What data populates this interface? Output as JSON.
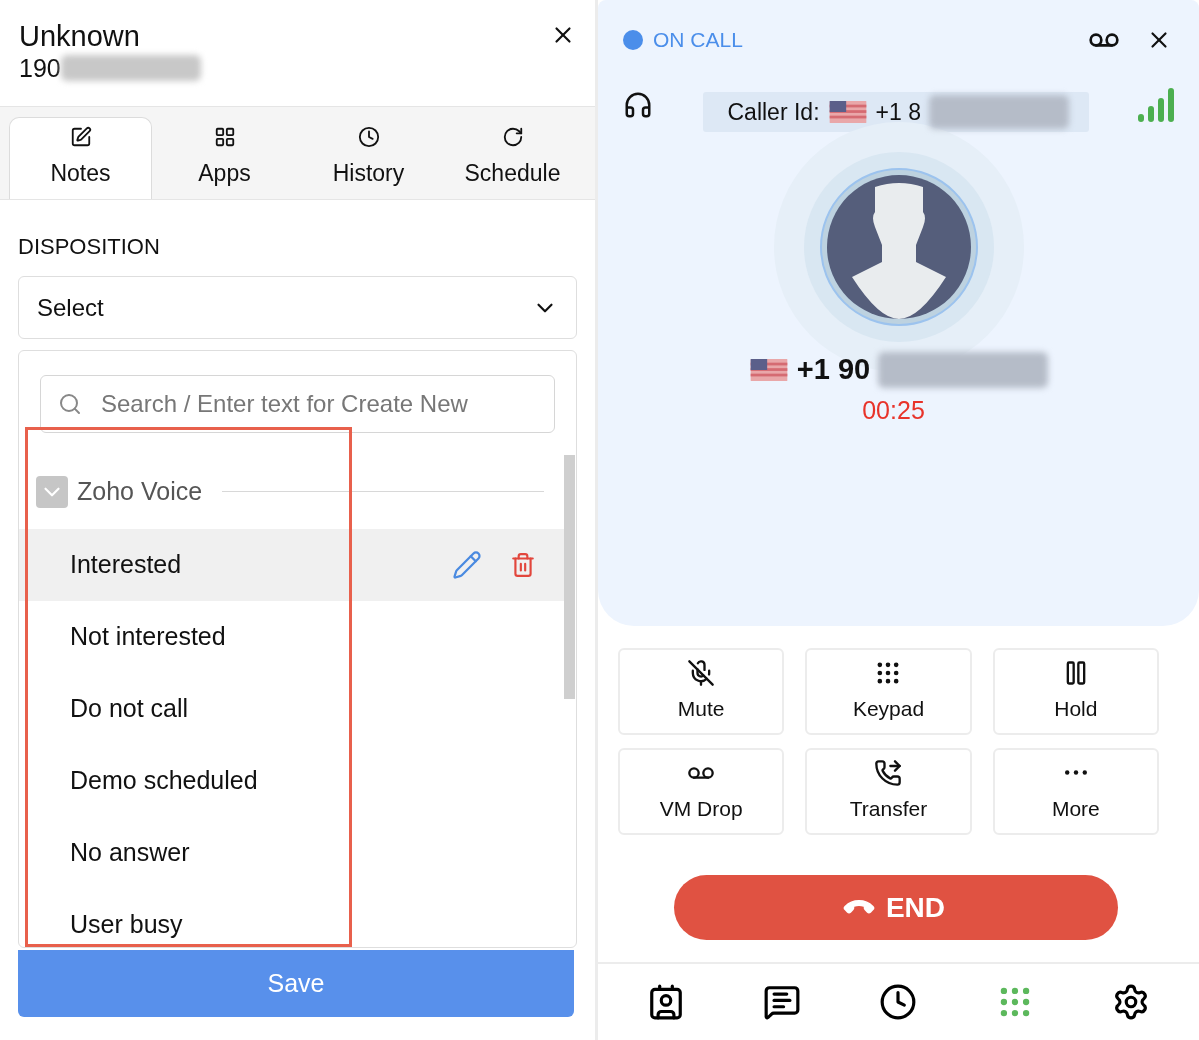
{
  "contact": {
    "name": "Unknown",
    "number": "190"
  },
  "tabs": [
    {
      "label": "Notes",
      "selected": true
    },
    {
      "label": "Apps",
      "selected": false
    },
    {
      "label": "History",
      "selected": false
    },
    {
      "label": "Schedule",
      "selected": false
    }
  ],
  "disposition": {
    "label": "DISPOSITION",
    "value": "Select",
    "search_placeholder": "Search / Enter text for Create New",
    "group": {
      "name": "Zoho Voice",
      "expanded": true
    },
    "options": [
      {
        "label": "Interested",
        "highlighted": true
      },
      {
        "label": "Not interested",
        "highlighted": false
      },
      {
        "label": "Do not call",
        "highlighted": false
      },
      {
        "label": "Demo scheduled",
        "highlighted": false
      },
      {
        "label": "No answer",
        "highlighted": false
      },
      {
        "label": "User busy",
        "highlighted": false
      }
    ]
  },
  "save_button": "Save",
  "call": {
    "status": "ON CALL",
    "caller_id_label": "Caller Id:",
    "caller_id_number": "+1 8",
    "number": "+1 90",
    "timer": "00:25"
  },
  "actions": [
    "Mute",
    "Keypad",
    "Hold",
    "VM Drop",
    "Transfer",
    "More"
  ],
  "end_button": "END",
  "bottom_nav": [
    {
      "selected": false
    },
    {
      "selected": false
    },
    {
      "selected": false
    },
    {
      "selected": true
    },
    {
      "selected": false
    }
  ]
}
